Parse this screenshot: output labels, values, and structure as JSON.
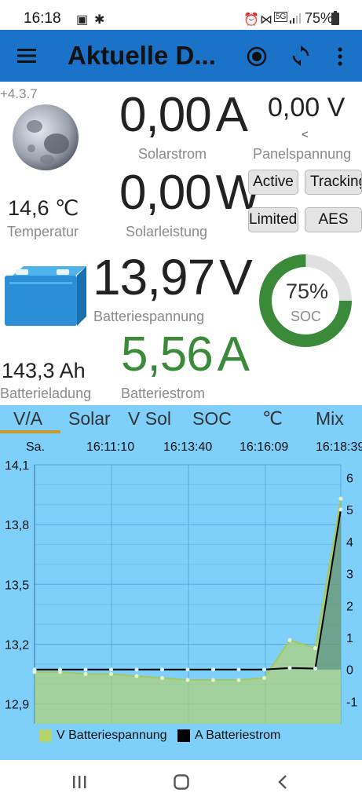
{
  "status": {
    "time": "16:18",
    "battery": "75%",
    "network": "5G"
  },
  "appbar": {
    "title": "Aktuelle D..."
  },
  "version": "+4.3.7",
  "solar_current": {
    "value": "0,00",
    "unit": "A",
    "label": "Solarstrom"
  },
  "panel_voltage": {
    "value": "0,00 V",
    "indicator": "<",
    "label": "Panelspannung"
  },
  "temperature": {
    "value": "14,6 ℃",
    "label": "Temperatur"
  },
  "solar_power": {
    "value": "0,00",
    "unit": "W",
    "label": "Solarleistung"
  },
  "buttons": {
    "active": "Active",
    "tracking": "Tracking",
    "limited": "Limited",
    "aes": "AES"
  },
  "battery_voltage": {
    "value": "13,97",
    "unit": "V",
    "label": "Batteriespannung"
  },
  "soc": {
    "percent": 75,
    "value": "75%",
    "label": "SOC"
  },
  "battery_charge": {
    "value": "143,3 Ah",
    "label": "Batterieladung"
  },
  "battery_current": {
    "value": "5,56",
    "unit": "A",
    "label": "Batteriestrom"
  },
  "tabs": [
    "V/A",
    "Solar",
    "V Sol",
    "SOC",
    "℃",
    "Mix"
  ],
  "time_labels": [
    "Sa.",
    "16:11:10",
    "16:13:40",
    "16:16:09",
    "16:18:39"
  ],
  "colors": {
    "appbar": "#1a73c8",
    "green": "#3a8a3a",
    "chart_bg": "#7fcffb",
    "voltage_series": "#b5d36b",
    "current_series": "#000000"
  },
  "chart_data": {
    "type": "area",
    "x": [
      "16:08:40",
      "16:09:40",
      "16:10:40",
      "16:11:10",
      "16:12:10",
      "16:13:10",
      "16:13:40",
      "16:14:40",
      "16:15:40",
      "16:16:09",
      "16:16:40",
      "16:17:40",
      "16:18:39"
    ],
    "series": [
      {
        "name": "V Batteriespannung",
        "axis": "left",
        "values": [
          13.06,
          13.06,
          13.05,
          13.05,
          13.04,
          13.03,
          13.02,
          13.02,
          13.02,
          13.03,
          13.22,
          13.18,
          13.93
        ]
      },
      {
        "name": "A Batteriestrom",
        "axis": "right",
        "values": [
          0,
          0,
          0,
          0,
          0,
          0,
          0,
          0,
          0,
          0,
          0.05,
          0.03,
          5.0
        ]
      }
    ],
    "y_left": {
      "ticks": [
        "14,1",
        "13,8",
        "13,5",
        "13,2",
        "12,9"
      ],
      "ylim": [
        12.8,
        14.1
      ]
    },
    "y_right": {
      "ticks": [
        "6",
        "5",
        "4",
        "3",
        "2",
        "1",
        "0",
        "-1"
      ],
      "ylim": [
        -1.7,
        6.4
      ]
    },
    "grid": true,
    "legend": "bottom"
  }
}
